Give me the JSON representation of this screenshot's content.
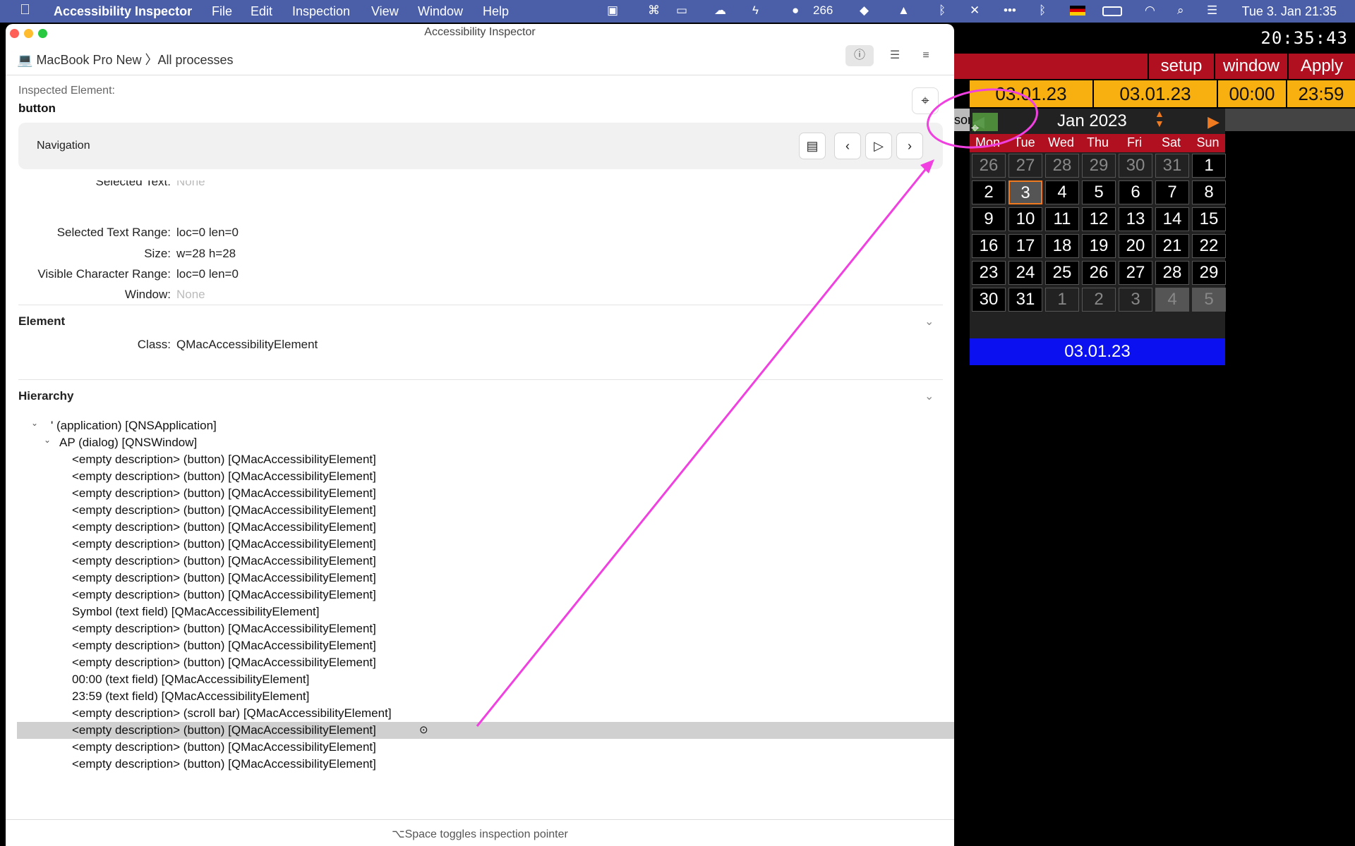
{
  "menubar": {
    "app_name": "Accessibility Inspector",
    "menus": [
      "File",
      "Edit",
      "Inspection",
      "View",
      "Window",
      "Help"
    ],
    "tray_count": "266",
    "clock": "Tue 3. Jan  21:35"
  },
  "window": {
    "title": "Accessibility Inspector",
    "breadcrumb_device": "MacBook Pro New",
    "breadcrumb_sep": "〉",
    "breadcrumb_process": "All processes"
  },
  "inspected": {
    "label": "Inspected Element:",
    "name": "button"
  },
  "navigation": {
    "title": "Navigation"
  },
  "properties": [
    {
      "key": "Selected Text:",
      "value": "None",
      "muted": true
    },
    {
      "key": "Selected Text Range:",
      "value": "loc=0 len=0",
      "muted": false
    },
    {
      "key": "Size:",
      "value": "w=28 h=28",
      "muted": false
    },
    {
      "key": "Visible Character Range:",
      "value": "loc=0 len=0",
      "muted": false
    },
    {
      "key": "Window:",
      "value": "None",
      "muted": true
    }
  ],
  "element_section": {
    "title": "Element",
    "class_key": "Class:",
    "class_value": "QMacAccessibilityElement"
  },
  "hierarchy": {
    "title": "Hierarchy",
    "rows": [
      {
        "indent": 0,
        "toggle": "⌄",
        "text": "'        (application) [QNSApplication]"
      },
      {
        "indent": 1,
        "toggle": "⌄",
        "text": "AP (dialog) [QNSWindow]"
      },
      {
        "indent": 2,
        "toggle": "",
        "text": "<empty description> (button) [QMacAccessibilityElement]"
      },
      {
        "indent": 2,
        "toggle": "",
        "text": "<empty description> (button) [QMacAccessibilityElement]"
      },
      {
        "indent": 2,
        "toggle": "",
        "text": "<empty description> (button) [QMacAccessibilityElement]"
      },
      {
        "indent": 2,
        "toggle": "",
        "text": "<empty description> (button) [QMacAccessibilityElement]"
      },
      {
        "indent": 2,
        "toggle": "",
        "text": "<empty description> (button) [QMacAccessibilityElement]"
      },
      {
        "indent": 2,
        "toggle": "",
        "text": "<empty description> (button) [QMacAccessibilityElement]"
      },
      {
        "indent": 2,
        "toggle": "",
        "text": "<empty description> (button) [QMacAccessibilityElement]"
      },
      {
        "indent": 2,
        "toggle": "",
        "text": "<empty description> (button) [QMacAccessibilityElement]"
      },
      {
        "indent": 2,
        "toggle": "",
        "text": "<empty description> (button) [QMacAccessibilityElement]"
      },
      {
        "indent": 2,
        "toggle": "",
        "text": "Symbol (text field) [QMacAccessibilityElement]"
      },
      {
        "indent": 2,
        "toggle": "",
        "text": "<empty description> (button) [QMacAccessibilityElement]"
      },
      {
        "indent": 2,
        "toggle": "",
        "text": "<empty description> (button) [QMacAccessibilityElement]"
      },
      {
        "indent": 2,
        "toggle": "",
        "text": "<empty description> (button) [QMacAccessibilityElement]"
      },
      {
        "indent": 2,
        "toggle": "",
        "text": "00:00 (text field) [QMacAccessibilityElement]"
      },
      {
        "indent": 2,
        "toggle": "",
        "text": "23:59 (text field) [QMacAccessibilityElement]"
      },
      {
        "indent": 2,
        "toggle": "",
        "text": "<empty description> (scroll bar) [QMacAccessibilityElement]"
      },
      {
        "indent": 2,
        "toggle": "",
        "text": "<empty description> (button) [QMacAccessibilityElement]",
        "selected": true
      },
      {
        "indent": 2,
        "toggle": "",
        "text": "<empty description> (button) [QMacAccessibilityElement]"
      },
      {
        "indent": 2,
        "toggle": "",
        "text": "<empty description> (button) [QMacAccessibilityElement]"
      }
    ]
  },
  "footer": "⌥Space toggles inspection pointer",
  "calendar_app": {
    "digital_clock": "20:35:43",
    "buttons": [
      "setup",
      "window",
      "Apply"
    ],
    "fields": [
      "03.01.23",
      "03.01.23",
      "00:00",
      "23:59"
    ],
    "sliver_text": "sor",
    "month": "Jan 2023",
    "weekdays": [
      "Mon",
      "Tue",
      "Wed",
      "Thu",
      "Fri",
      "Sat",
      "Sun"
    ],
    "weeks": [
      [
        "26",
        "27",
        "28",
        "29",
        "30",
        "31",
        "1"
      ],
      [
        "2",
        "3",
        "4",
        "5",
        "6",
        "7",
        "8"
      ],
      [
        "9",
        "10",
        "11",
        "12",
        "13",
        "14",
        "15"
      ],
      [
        "16",
        "17",
        "18",
        "19",
        "20",
        "21",
        "22"
      ],
      [
        "23",
        "24",
        "25",
        "26",
        "27",
        "28",
        "29"
      ],
      [
        "30",
        "31",
        "1",
        "2",
        "3",
        "4",
        "5"
      ]
    ],
    "selected_day": "3",
    "selected_date": "03.01.23"
  },
  "colors": {
    "menubar": "#4a5fa8",
    "accent_red": "#b01020",
    "accent_orange": "#f8b010",
    "selected_blue": "#0a10f0",
    "annotation_magenta": "#f040e0"
  }
}
